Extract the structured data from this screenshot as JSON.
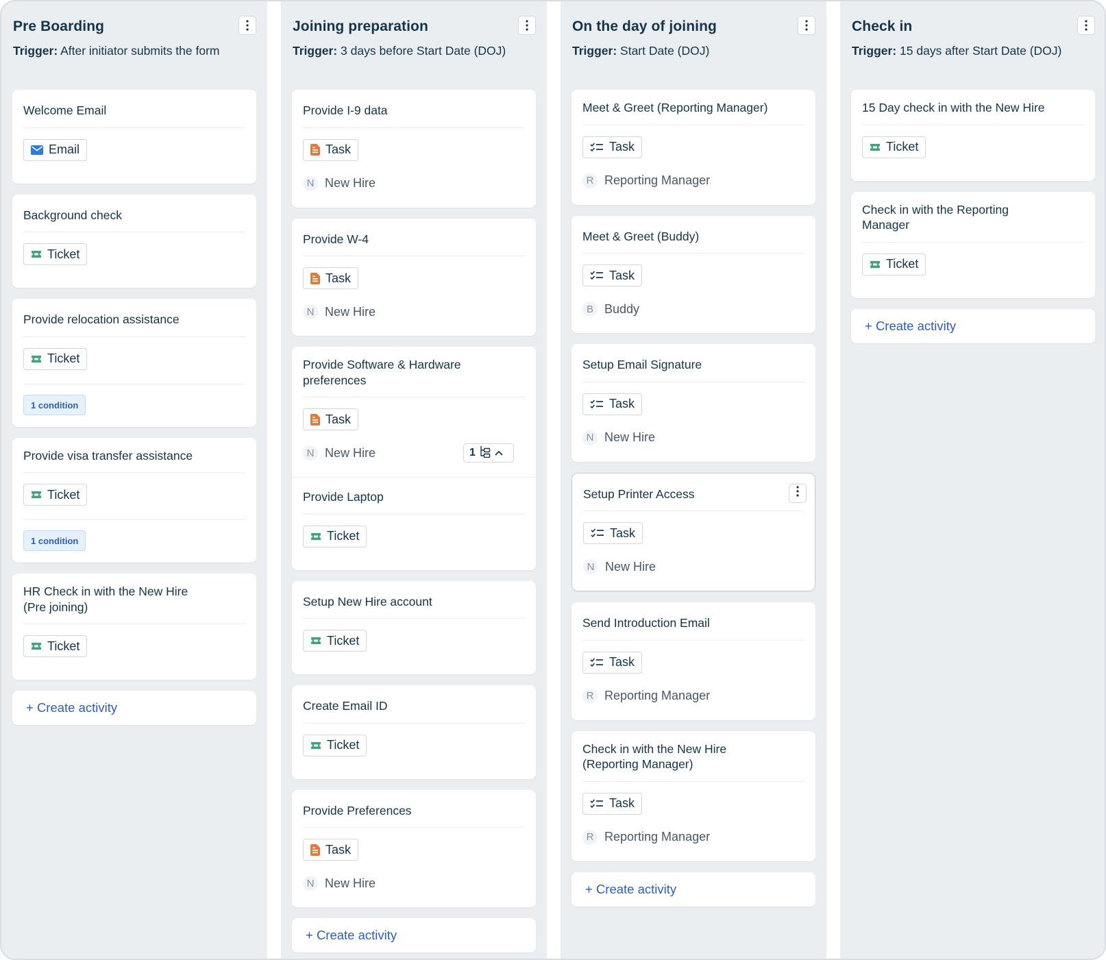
{
  "colors": {
    "accent": "#2c5cc5",
    "column_bg": "#ebeef1",
    "email_icon": "#2c7be5",
    "task_icon": "#e07b39",
    "ticket_icon": "#3fa47a"
  },
  "columns": [
    {
      "title": "Pre Boarding",
      "trigger_label": "Trigger:",
      "trigger_text": "After initiator submits the form",
      "cards": [
        {
          "title": "Welcome Email",
          "type": "Email",
          "icon": "email-icon"
        },
        {
          "title": "Background check",
          "type": "Ticket",
          "icon": "ticket-icon"
        },
        {
          "title": "Provide relocation assistance",
          "type": "Ticket",
          "icon": "ticket-icon",
          "condition": "1 condition"
        },
        {
          "title": "Provide visa transfer assistance",
          "type": "Ticket",
          "icon": "ticket-icon",
          "condition": "1 condition"
        },
        {
          "title": "HR Check in with the New Hire (Pre joining)",
          "type": "Ticket",
          "icon": "ticket-icon"
        }
      ],
      "create_label": "+ Create activity"
    },
    {
      "title": "Joining preparation",
      "trigger_label": "Trigger:",
      "trigger_text": "3 days before Start Date (DOJ)",
      "cards": [
        {
          "title": "Provide I-9 data",
          "type": "Task",
          "icon": "document-task-icon",
          "assignee_initial": "N",
          "assignee": "New Hire"
        },
        {
          "title": "Provide W-4",
          "type": "Task",
          "icon": "document-task-icon",
          "assignee_initial": "N",
          "assignee": "New Hire"
        },
        {
          "title": "Provide Software & Hardware preferences",
          "type": "Task",
          "icon": "document-task-icon",
          "assignee_initial": "N",
          "assignee": "New Hire",
          "subtask_count": "1",
          "child": {
            "title": "Provide Laptop",
            "type": "Ticket",
            "icon": "ticket-icon"
          }
        },
        {
          "title": "Setup New Hire account",
          "type": "Ticket",
          "icon": "ticket-icon"
        },
        {
          "title": "Create Email ID",
          "type": "Ticket",
          "icon": "ticket-icon"
        },
        {
          "title": "Provide Preferences",
          "type": "Task",
          "icon": "document-task-icon",
          "assignee_initial": "N",
          "assignee": "New Hire"
        }
      ],
      "create_label": "+ Create activity"
    },
    {
      "title": "On the day of joining",
      "trigger_label": "Trigger:",
      "trigger_text": "Start Date (DOJ)",
      "cards": [
        {
          "title": "Meet & Greet (Reporting Manager)",
          "type": "Task",
          "icon": "checklist-icon",
          "assignee_initial": "R",
          "assignee": "Reporting Manager"
        },
        {
          "title": "Meet & Greet (Buddy)",
          "type": "Task",
          "icon": "checklist-icon",
          "assignee_initial": "B",
          "assignee": "Buddy"
        },
        {
          "title": "Setup Email Signature",
          "type": "Task",
          "icon": "checklist-icon",
          "assignee_initial": "N",
          "assignee": "New Hire"
        },
        {
          "title": "Setup Printer Access",
          "type": "Task",
          "icon": "checklist-icon",
          "assignee_initial": "N",
          "assignee": "New Hire",
          "selected": true
        },
        {
          "title": "Send Introduction Email",
          "type": "Task",
          "icon": "checklist-icon",
          "assignee_initial": "R",
          "assignee": "Reporting Manager"
        },
        {
          "title": "Check in with the New Hire (Reporting Manager)",
          "type": "Task",
          "icon": "checklist-icon",
          "assignee_initial": "R",
          "assignee": "Reporting Manager"
        }
      ],
      "create_label": "+ Create activity"
    },
    {
      "title": "Check in",
      "trigger_label": "Trigger:",
      "trigger_text": "15 days after Start Date (DOJ)",
      "cards": [
        {
          "title": "15 Day check in with the New Hire",
          "type": "Ticket",
          "icon": "ticket-icon"
        },
        {
          "title": "Check in with the Reporting Manager",
          "type": "Ticket",
          "icon": "ticket-icon"
        }
      ],
      "create_label": "+ Create activity"
    }
  ]
}
